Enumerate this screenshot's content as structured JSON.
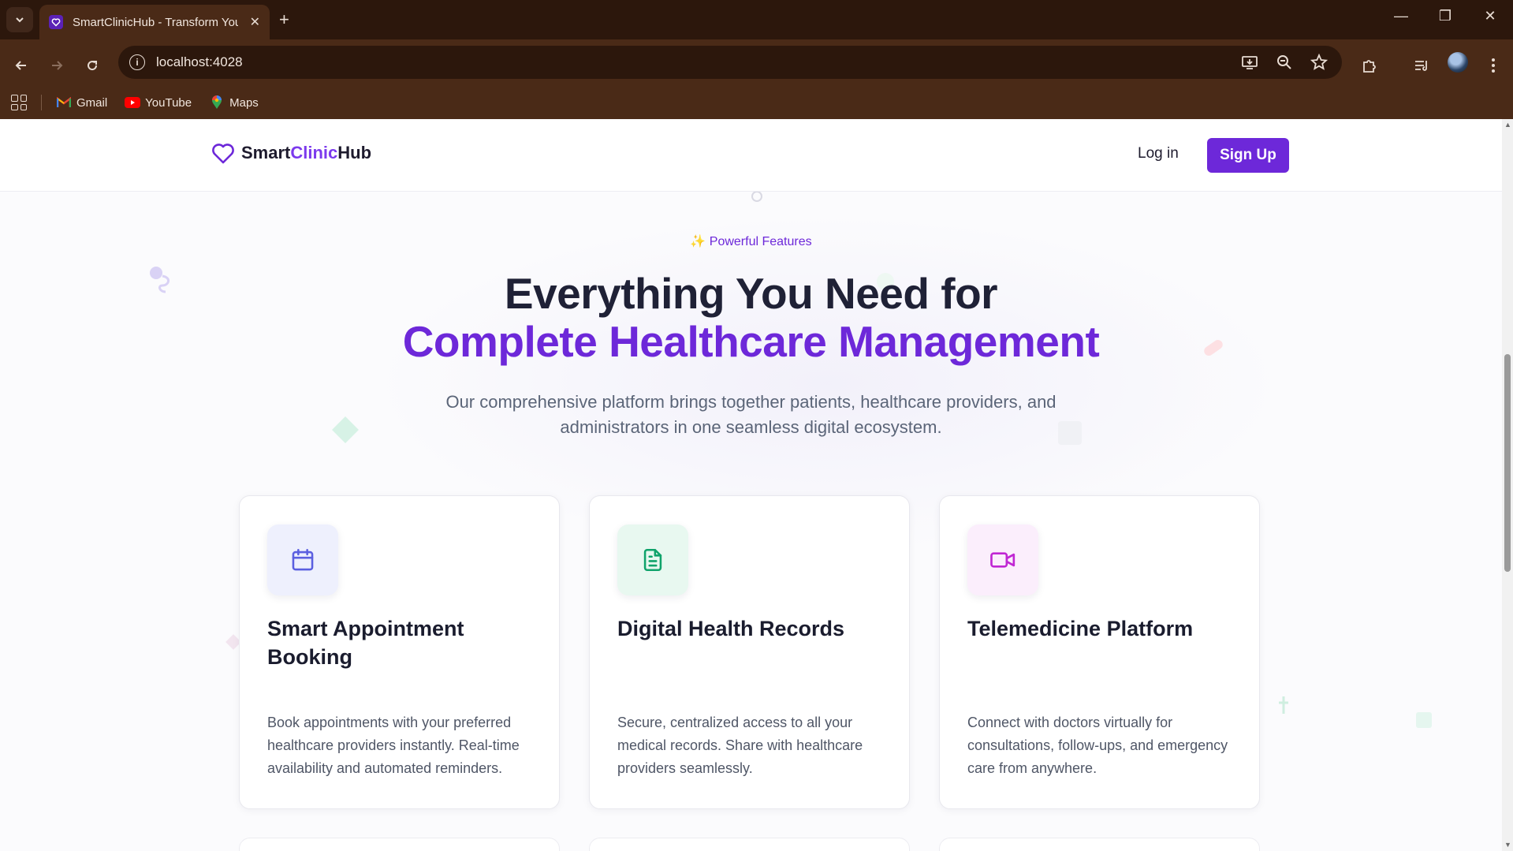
{
  "browser": {
    "tab_title": "SmartClinicHub - Transform You",
    "url": "localhost:4028",
    "bookmarks": [
      {
        "label": "Gmail",
        "icon": "gmail-icon"
      },
      {
        "label": "YouTube",
        "icon": "youtube-icon"
      },
      {
        "label": "Maps",
        "icon": "maps-icon"
      }
    ]
  },
  "site": {
    "logo_part1": "Smart",
    "logo_part2": "Clinic",
    "logo_part3": "Hub",
    "login_label": "Log in",
    "signup_label": "Sign Up",
    "brand_color": "#6d28d9"
  },
  "hero": {
    "badge_icon": "✨",
    "badge_text": "Powerful Features",
    "title_line1": "Everything You Need for",
    "title_line2": "Complete Healthcare Management",
    "subtitle": "Our comprehensive platform brings together patients, healthcare providers, and administrators in one seamless digital ecosystem."
  },
  "features": [
    {
      "title": "Smart Appointment Booking",
      "description": "Book appointments with your preferred healthcare providers instantly. Real-time availability and automated reminders.",
      "icon": "calendar-icon",
      "icon_color": "#5b5fe0",
      "icon_bg": "#eef0fd"
    },
    {
      "title": "Digital Health Records",
      "description": "Secure, centralized access to all your medical records. Share with healthcare providers seamlessly.",
      "icon": "document-icon",
      "icon_color": "#10a36b",
      "icon_bg": "#e8f8f0"
    },
    {
      "title": "Telemedicine Platform",
      "description": "Connect with doctors virtually for consultations, follow-ups, and emergency care from anywhere.",
      "icon": "video-camera-icon",
      "icon_color": "#c026d3",
      "icon_bg": "#fbeefc"
    }
  ]
}
